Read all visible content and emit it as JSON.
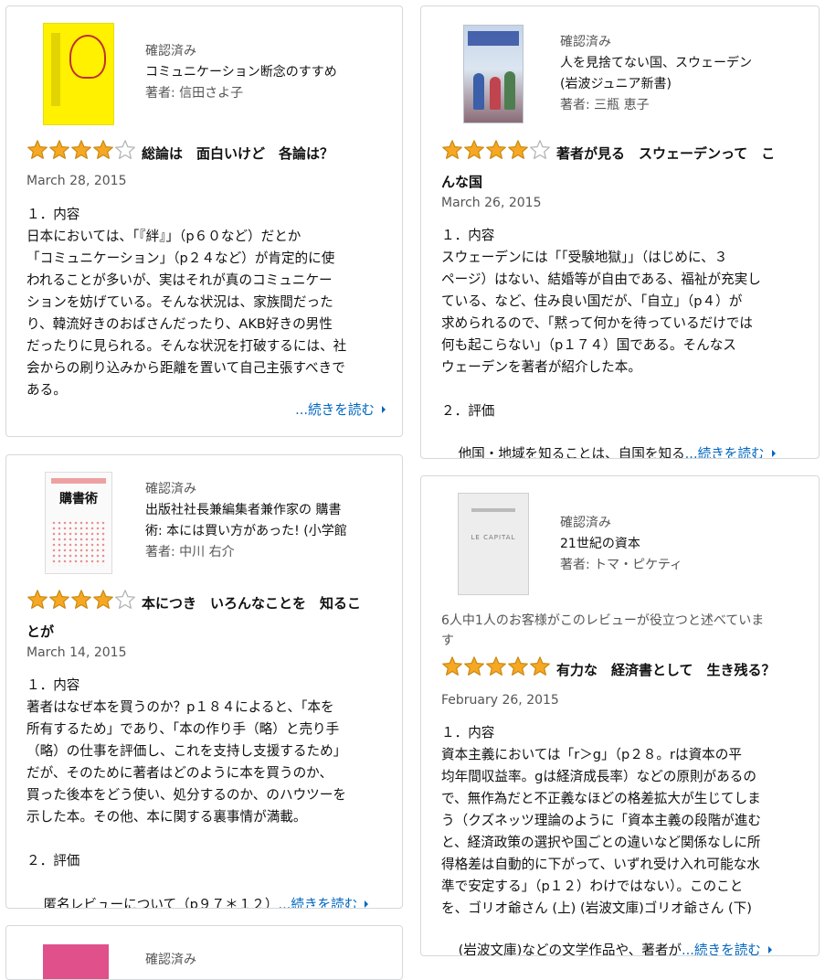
{
  "colors": {
    "star_fill": "#f7a823",
    "star_stroke": "#c98810",
    "link": "#0066c0",
    "border": "#d5d9d9"
  },
  "reviews": [
    {
      "status": "確認済み",
      "title_lines": [
        "コミュニケーション断念のすすめ"
      ],
      "author": "著者: 信田さよ子",
      "stars": 4,
      "heading_lines": [
        "総論は　面白いけど　各論は？"
      ],
      "date": "March 28, 2015",
      "helpful": "",
      "body": "１．内容\n日本においては、「『絆』」（p６０など）だとか\n「コミュニケーション」（p２４など）が肯定的に使\nわれることが多いが、実はそれが真のコミュニケー\nションを妨げている。そんな状況は、家族間だった\nり、韓流好きのおばさんだったり、AKB好きの男性\nだったりに見られる。そんな状況を打破するには、社\n会からの刷り込みから距離を置いて自己主張すべきで\nある。",
      "more": "...続きを読む",
      "last_line": "",
      "cover_text": "コミュニケーション断念のすすめ"
    },
    {
      "status": "確認済み",
      "title_lines": [
        "出版社社長兼編集者兼作家の 購書",
        "術: 本には買い方があった! (小学館"
      ],
      "author": "著者: 中川 右介",
      "stars": 4,
      "heading_lines": [
        "本につき　いろんなことを　知るこ",
        "とが"
      ],
      "date": "March 14, 2015",
      "helpful": "",
      "body": "１．内容\n著者はなぜ本を買うのか？p１８４によると、「本を\n所有するため」であり、「本の作り手（略）と売り手\n（略）の仕事を評価し、これを支持し支援するため」\nだが、そのために著者はどのように本を買うのか、\n買った後本をどう使い、処分するのか、のハウツーを\n示した本。その他、本に関する裏事情が満載。\n\n２．評価",
      "more": "...続きを読む",
      "last_line": "匿名レビューについて（p９７＊１２）",
      "cover_text": "購書術"
    },
    {
      "status": "確認済み",
      "title_lines": [
        "人を見捨てない国、スウェーデン",
        "(岩波ジュニア新書)"
      ],
      "author": "著者: 三瓶 恵子",
      "stars": 4,
      "heading_lines": [
        "著者が見る　スウェーデンって　こ",
        "んな国"
      ],
      "date": "March 26, 2015",
      "helpful": "",
      "body": "１．内容\nスウェーデンには「「受験地獄」」（はじめに、３\nページ）はない、結婚等が自由である、福祉が充実し\nている、など、住み良い国だが、「自立」（p４）が\n求められるので、「黙って何かを待っているだけでは\n何も起こらない」（p１７４）国である。そんなス\nウェーデンを著者が紹介した本。\n\n２．評価",
      "more": "...続きを読む",
      "last_line": "他国・地域を知ることは、自国を知る",
      "cover_text": "人を見捨てない国、スウェーデン"
    },
    {
      "status": "確認済み",
      "title_lines": [
        "21世紀の資本"
      ],
      "author": "著者: トマ・ピケティ",
      "stars": 5,
      "heading_lines": [
        "有力な　経済書として　生き残る？"
      ],
      "date": "February 26, 2015",
      "helpful": "6人中1人のお客様がこのレビューが役立つと述べていま\nす",
      "body": "１．内容\n資本主義においては「r＞g」（p２８。rは資本の平\n均年間収益率。gは経済成長率）などの原則があるの\nで、無作為だと不正義なほどの格差拡大が生じてしま\nう（クズネッツ理論のように「資本主義の段階が進む\nと、経済政策の選択や国ごとの違いなど関係なしに所\n得格差は自動的に下がって、いずれ受け入れ可能な水\n準で安定する」（p１２）わけではない）。このこと\nを、ゴリオ爺さん (上) (岩波文庫)ゴリオ爺さん (下)",
      "more": "...続きを読む",
      "last_line": "(岩波文庫)などの文学作品や、著者が",
      "cover_text": "LE CAPITAL"
    },
    {
      "status": "確認済み"
    }
  ]
}
